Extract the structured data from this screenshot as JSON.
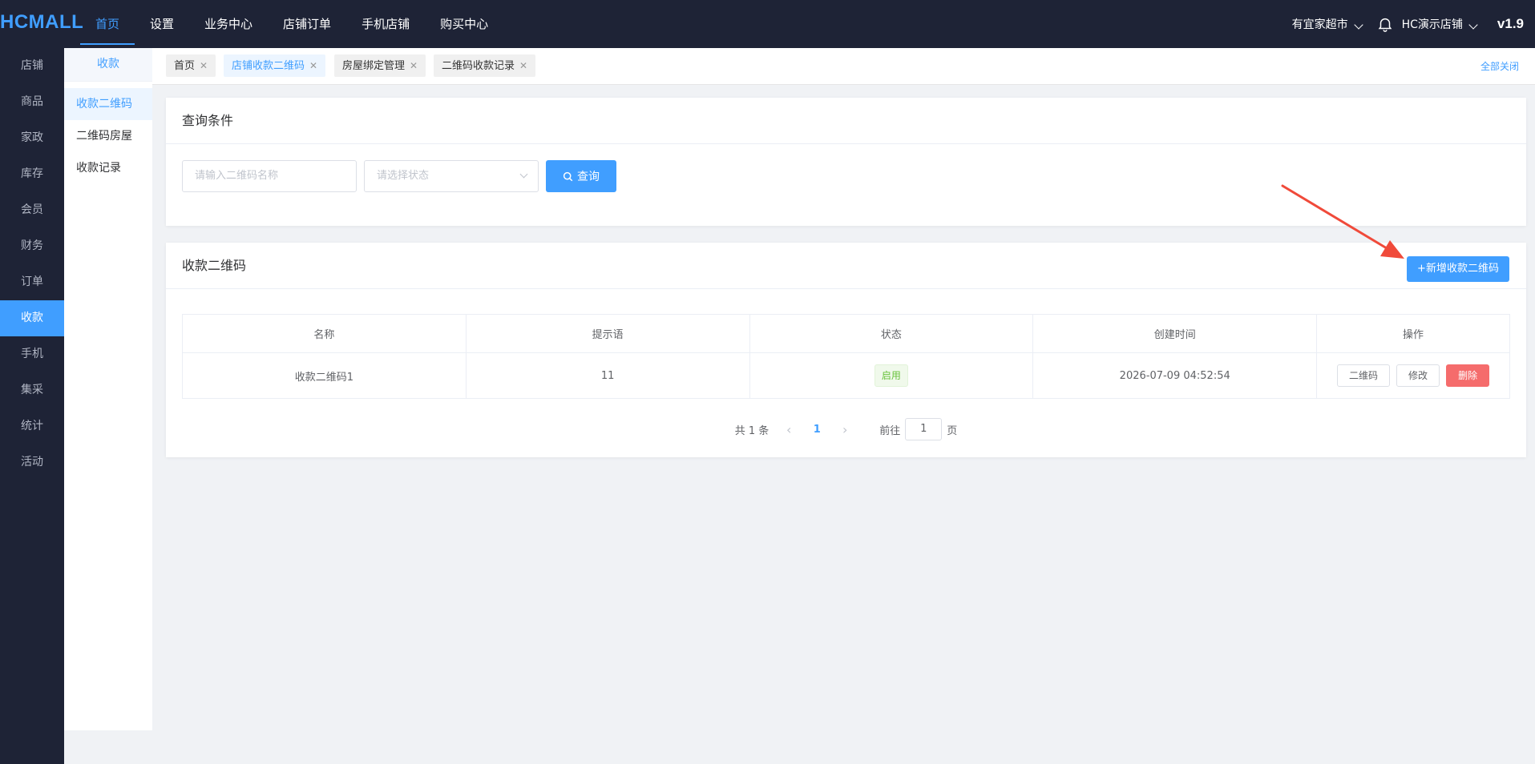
{
  "brand": {
    "logo": "HCMALL"
  },
  "topnav": [
    "首页",
    "设置",
    "业务中心",
    "店铺订单",
    "手机店铺",
    "购买中心"
  ],
  "top_right": {
    "store_select": "有宜家超市",
    "shop_select": "HC演示店铺",
    "version": "v1.9"
  },
  "sidebar": [
    "店铺",
    "商品",
    "家政",
    "库存",
    "会员",
    "财务",
    "订单",
    "收款",
    "手机",
    "集采",
    "统计",
    "活动"
  ],
  "submenu": {
    "title": "收款",
    "items": [
      "收款二维码",
      "二维码房屋",
      "收款记录"
    ]
  },
  "tags": {
    "items": [
      "首页",
      "店铺收款二维码",
      "房屋绑定管理",
      "二维码收款记录"
    ],
    "close_all": "全部关闭"
  },
  "query": {
    "title": "查询条件",
    "name_placeholder": "请输入二维码名称",
    "status_placeholder": "请选择状态",
    "search_label": "查询"
  },
  "list": {
    "title": "收款二维码",
    "add_label": "+新增收款二维码",
    "columns": [
      "名称",
      "提示语",
      "状态",
      "创建时间",
      "操作"
    ],
    "rows": [
      {
        "name": "收款二维码1",
        "tip": "11",
        "status": "启用",
        "created": "2026-07-09 04:52:54",
        "actions": [
          "二维码",
          "修改",
          "删除"
        ]
      }
    ]
  },
  "pager": {
    "total": "共 1 条",
    "page": "1",
    "goto": "前往",
    "goto_value": "1",
    "page_unit": "页"
  },
  "colors": {
    "accent": "#409eff",
    "nav_bg": "#1e2336",
    "danger": "#f56c6c",
    "success": "#67c23a",
    "annotation": "#f04a3a"
  }
}
